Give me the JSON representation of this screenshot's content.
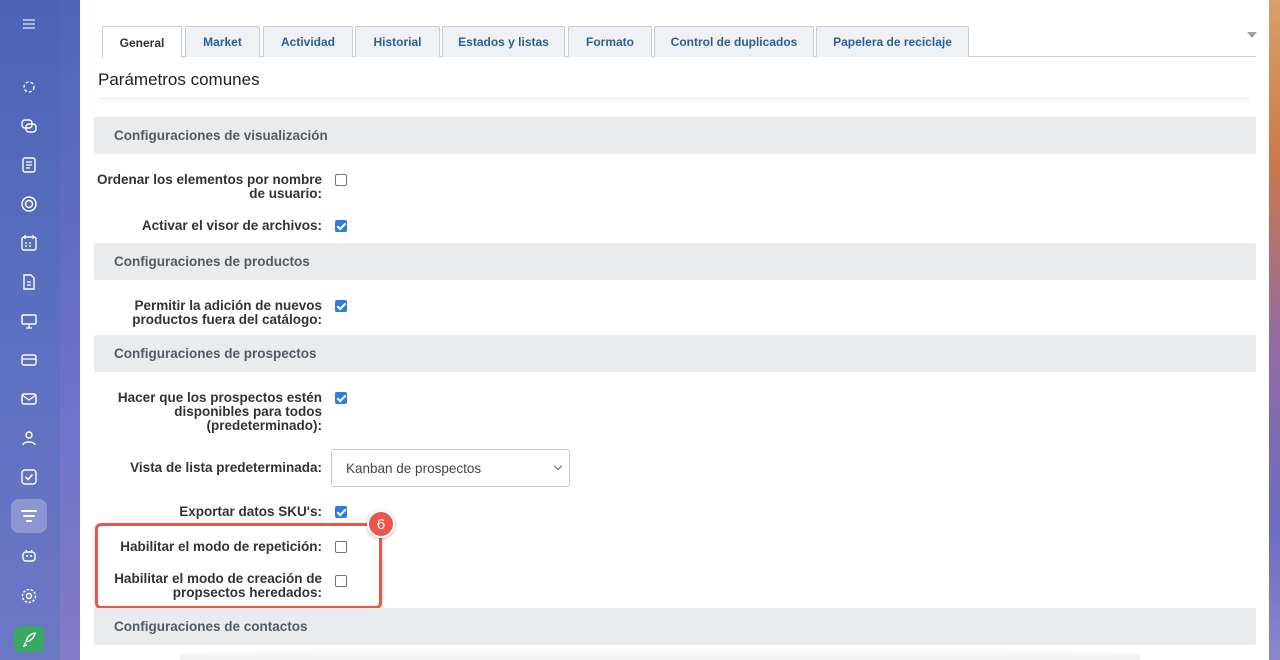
{
  "sidebar": {
    "items": [
      {
        "icon": "menu-icon"
      },
      {
        "icon": "feed-icon"
      },
      {
        "icon": "chat-icon"
      },
      {
        "icon": "tasks-icon"
      },
      {
        "icon": "circle-icon"
      },
      {
        "icon": "calendar-icon"
      },
      {
        "icon": "document-icon"
      },
      {
        "icon": "presentation-icon"
      },
      {
        "icon": "card-icon"
      },
      {
        "icon": "mail-icon"
      },
      {
        "icon": "contacts-icon"
      },
      {
        "icon": "checkbox-icon"
      },
      {
        "icon": "crm-funnel-icon"
      },
      {
        "icon": "robot-icon"
      },
      {
        "icon": "settings-icon"
      },
      {
        "icon": "rocket-icon"
      }
    ]
  },
  "tabs": [
    {
      "label": "General"
    },
    {
      "label": "Market"
    },
    {
      "label": "Actividad"
    },
    {
      "label": "Historial"
    },
    {
      "label": "Estados y listas"
    },
    {
      "label": "Formato"
    },
    {
      "label": "Control de duplicados"
    },
    {
      "label": "Papelera de reciclaje"
    }
  ],
  "page_title": "Parámetros comunes",
  "sections": {
    "display": "Configuraciones de visualización",
    "products": "Configuraciones de productos",
    "leads": "Configuraciones de prospectos",
    "contacts": "Configuraciones de contactos"
  },
  "rows": {
    "sort_by_user": {
      "label1": "Ordenar los elementos por nombre",
      "label2": "de usuario:",
      "checked": false
    },
    "file_viewer": {
      "label": "Activar el visor de archivos:",
      "checked": true
    },
    "new_products": {
      "label1": "Permitir la adición de nuevos",
      "label2": "productos fuera del catálogo:",
      "checked": true
    },
    "leads_available": {
      "label1": "Hacer que los prospectos estén",
      "label2": "disponibles para todos",
      "label3": "(predeterminado):",
      "checked": true
    },
    "default_list_view": {
      "label": "Vista de lista predeterminada:",
      "value": "Kanban de prospectos"
    },
    "export_sku": {
      "label": "Exportar datos SKU's:",
      "checked": true
    },
    "repeat_mode": {
      "label": "Habilitar el modo de repetición:",
      "checked": false
    },
    "inherited_leads": {
      "label1": "Habilitar el modo de creación de",
      "label2": "propsectos heredados:",
      "checked": false
    }
  },
  "annotation": {
    "badge": "6",
    "color": "#e8574c"
  },
  "colors": {
    "checkbox_checked": "#2f7be5",
    "tab_text": "#2f5f8f"
  }
}
